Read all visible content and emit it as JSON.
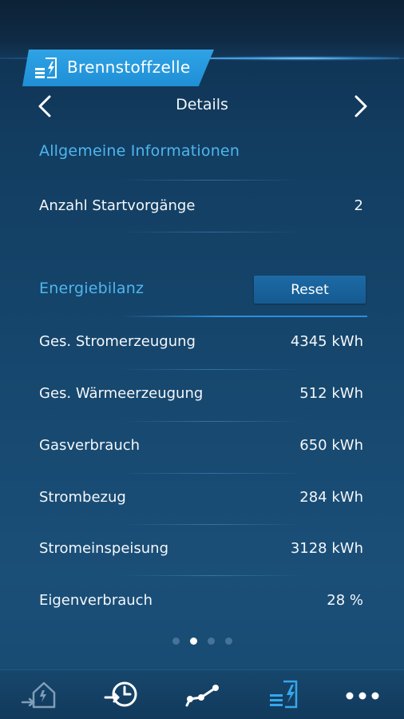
{
  "header": {
    "tab_title": "Brennstoffzelle",
    "tab_icon": "fuel-cell-icon"
  },
  "nav": {
    "title": "Details",
    "prev_icon": "chevron-left-icon",
    "next_icon": "chevron-right-icon"
  },
  "general": {
    "title": "Allgemeine Informationen",
    "rows": [
      {
        "label": "Anzahl Startvorgänge",
        "value": "2"
      }
    ]
  },
  "energy": {
    "title": "Energiebilanz",
    "reset_label": "Reset",
    "rows": [
      {
        "label": "Ges. Stromerzeugung",
        "value": "4345 kWh"
      },
      {
        "label": "Ges. Wärmeerzeugung",
        "value": "512 kWh"
      },
      {
        "label": "Gasverbrauch",
        "value": "650 kWh"
      },
      {
        "label": "Strombezug",
        "value": "284 kWh"
      },
      {
        "label": "Stromeinspeisung",
        "value": "3128 kWh"
      },
      {
        "label": "Eigenverbrauch",
        "value": "28 %"
      }
    ]
  },
  "pager": {
    "count": 4,
    "active_index": 1
  },
  "bottom_nav": [
    {
      "icon": "house-icon"
    },
    {
      "icon": "history-clock-icon"
    },
    {
      "icon": "graph-nodes-icon"
    },
    {
      "icon": "fuel-cell-icon",
      "active": true
    },
    {
      "icon": "more-dots-icon"
    }
  ],
  "colors": {
    "accent": "#2fa3e6",
    "section_title": "#4fb6ee",
    "reset_button": "#1d6aa5"
  }
}
